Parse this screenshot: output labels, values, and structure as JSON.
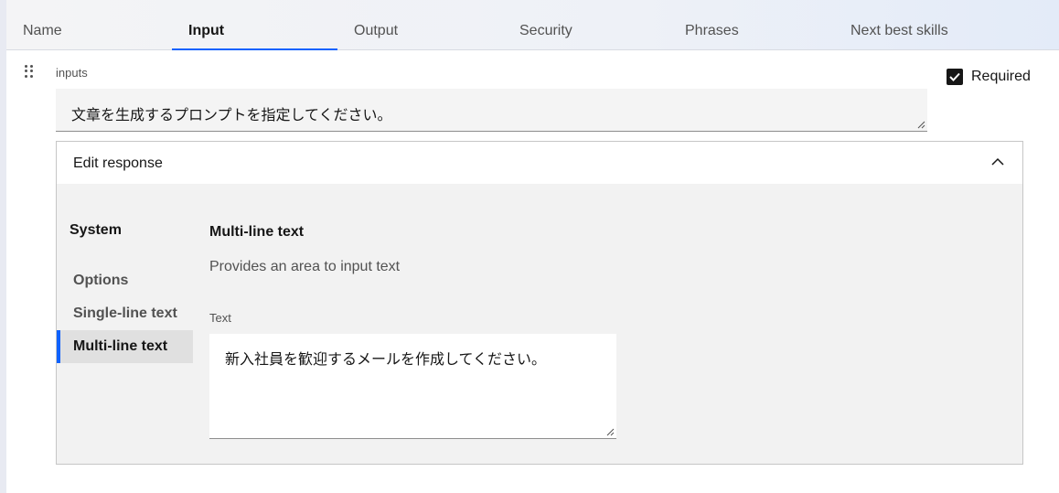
{
  "tabs": [
    {
      "label": "Name"
    },
    {
      "label": "Input"
    },
    {
      "label": "Output"
    },
    {
      "label": "Security"
    },
    {
      "label": "Phrases"
    },
    {
      "label": "Next best skills"
    }
  ],
  "active_tab": "Input",
  "inputs": {
    "label": "inputs",
    "value": "文章を生成するプロンプトを指定してください。"
  },
  "required": {
    "label": "Required",
    "checked": true
  },
  "edit_response": {
    "header": "Edit response",
    "expanded": true,
    "sidebar": {
      "title": "System",
      "items": [
        {
          "label": "Options"
        },
        {
          "label": "Single-line text"
        },
        {
          "label": "Multi-line text"
        }
      ],
      "selected": "Multi-line text"
    },
    "detail": {
      "title": "Multi-line text",
      "description": "Provides an area to input text",
      "text_label": "Text",
      "text_value": "新入社員を歓迎するメールを作成してください。"
    }
  },
  "colors": {
    "accent": "#0f62fe",
    "field_bg": "#f4f4f4",
    "body_bg": "#f2f2f2"
  }
}
